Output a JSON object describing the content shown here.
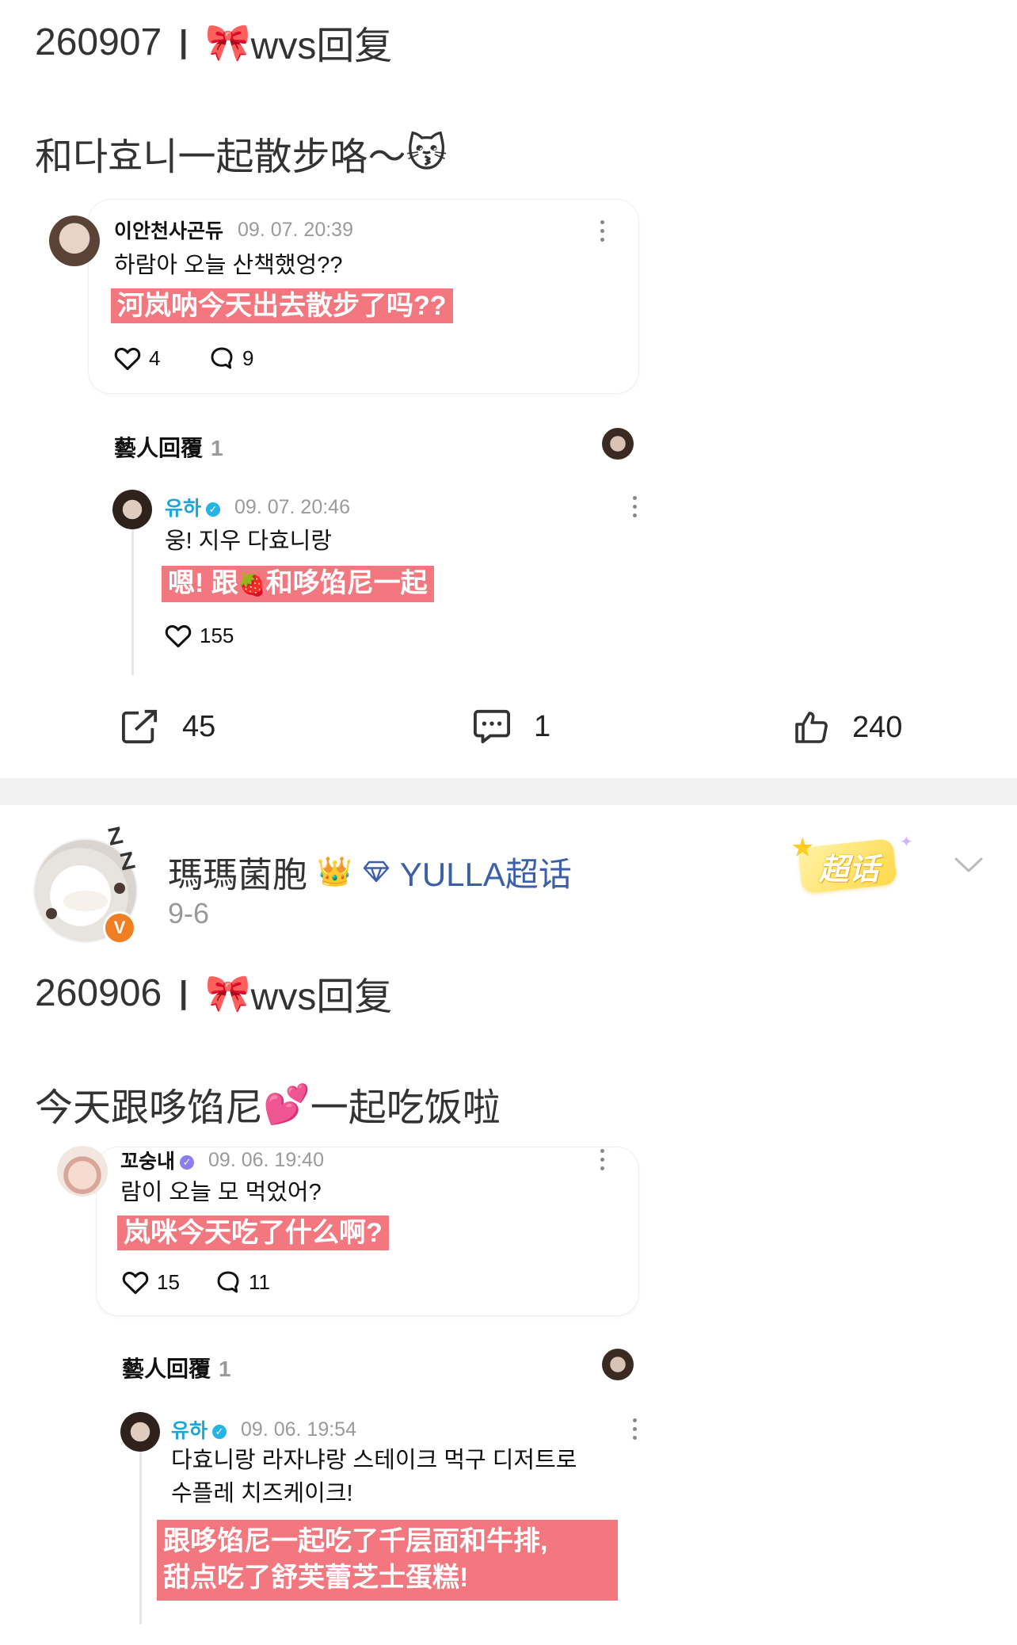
{
  "post1": {
    "header_code": "260907",
    "header_sep": "|",
    "header_emoji": "🎀",
    "header_label": "wvs回复",
    "text": "和다효니一起散步咯～",
    "text_emoji": "😽",
    "comment": {
      "username": "이안천사곤듀",
      "time": "09. 07. 20:39",
      "body": "하람아 오늘 산책했엉??",
      "translation": "河岚呐今天出去散步了吗??",
      "likes": "4",
      "replies": "9"
    },
    "artist_reply_label": "藝人回覆",
    "artist_reply_count": "1",
    "reply": {
      "username": "유하",
      "time": "09. 07. 20:46",
      "body": "웅! 지우 다효니랑",
      "translation_a": "嗯! 跟",
      "translation_emoji": "🍓",
      "translation_b": "和哆馅尼一起",
      "likes": "155"
    },
    "actions": {
      "share": "45",
      "comment": "1",
      "like": "240"
    }
  },
  "post2": {
    "user": {
      "name": "瑪瑪菌胞",
      "crown_emoji": "👑",
      "topic": "YULLA超话",
      "date": "9-6",
      "badge": "超话",
      "verified_mark": "V"
    },
    "header_code": "260906",
    "header_sep": "|",
    "header_emoji": "🎀",
    "header_label": "wvs回复",
    "text_a": "今天跟哆馅尼",
    "text_emoji": "💕",
    "text_b": "一起吃饭啦",
    "comment": {
      "username": "꼬숭내",
      "time": "09. 06. 19:40",
      "body": "람이 오늘 모 먹었어?",
      "translation": "岚咪今天吃了什么啊?",
      "likes": "15",
      "replies": "11"
    },
    "artist_reply_label": "藝人回覆",
    "artist_reply_count": "1",
    "reply": {
      "username": "유하",
      "time": "09. 06. 19:54",
      "body_line1": "다효니랑 라자냐랑 스테이크 먹구 디저트로",
      "body_line2": "수플레 치즈케이크!",
      "translation_line1": "跟哆馅尼一起吃了千层面和牛排,",
      "translation_line2": "甜点吃了舒芙蕾芝士蛋糕!"
    }
  },
  "colors": {
    "highlight": "#f3777f",
    "verified_blue": "#25b4e6",
    "topic_blue": "#3b5fa8",
    "badge_yellow": "#ffd84a",
    "divider": "#f2f2f2"
  }
}
